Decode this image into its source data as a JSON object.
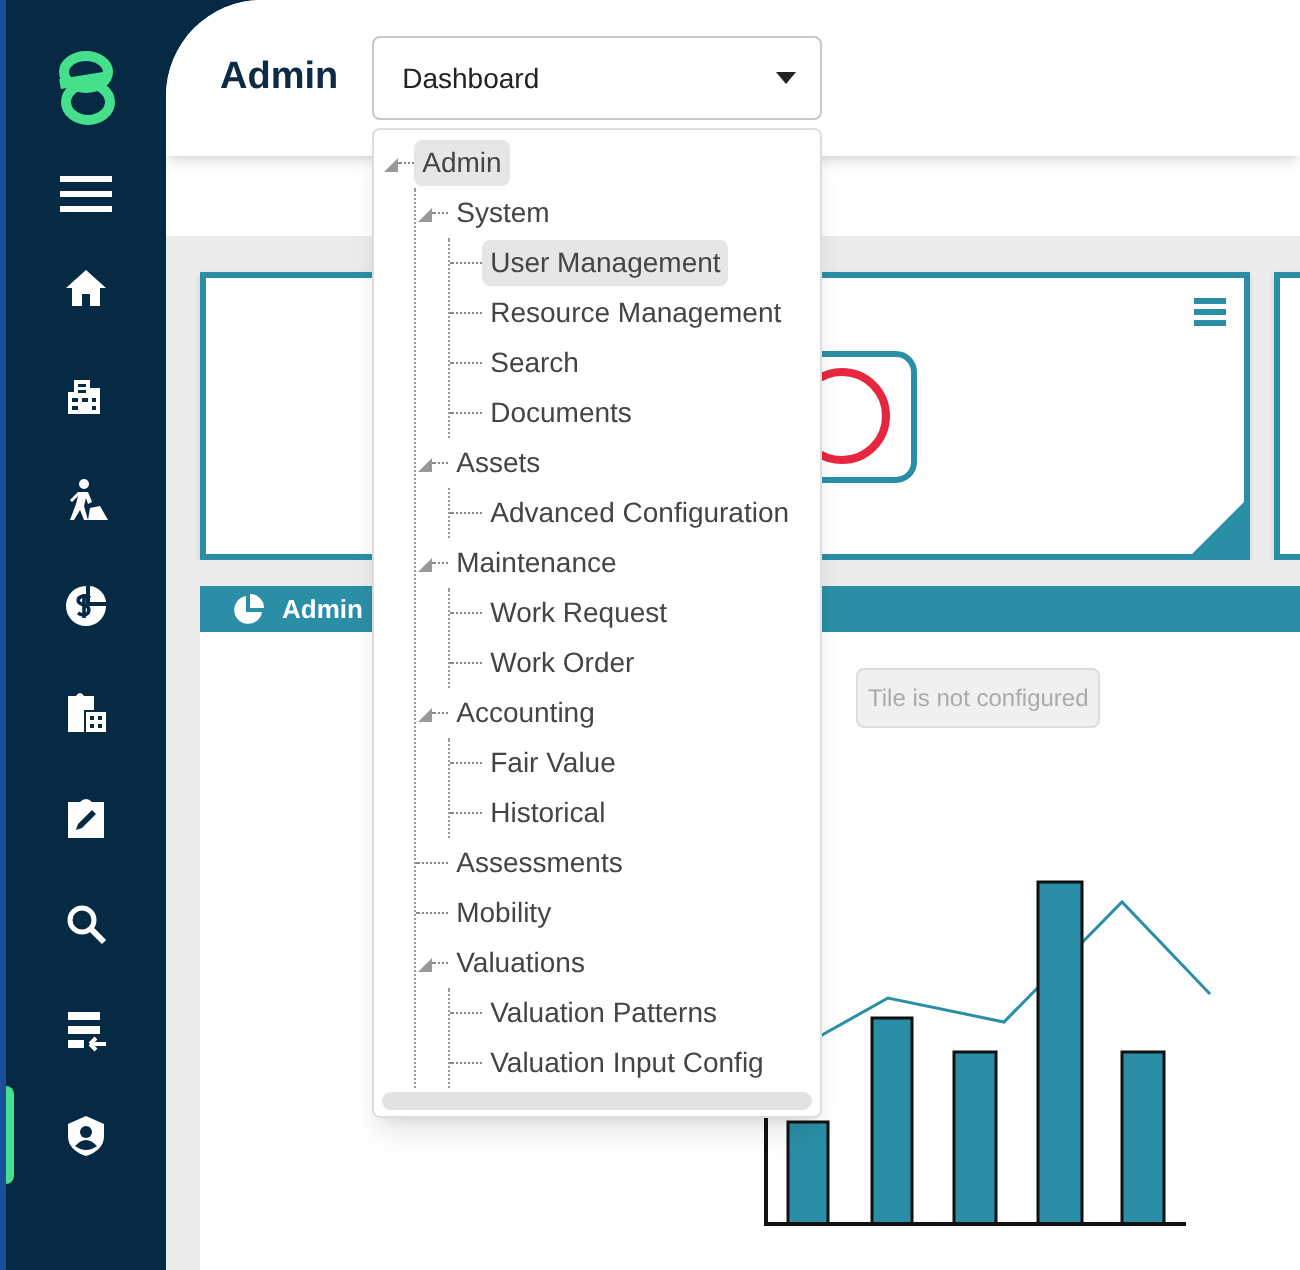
{
  "sidebar": {
    "items": [
      {
        "kind": "home",
        "selected": false
      },
      {
        "kind": "building",
        "selected": false
      },
      {
        "kind": "worker",
        "selected": false
      },
      {
        "kind": "dollar",
        "selected": false
      },
      {
        "kind": "calculator",
        "selected": false
      },
      {
        "kind": "edit",
        "selected": false
      },
      {
        "kind": "search",
        "selected": false
      },
      {
        "kind": "import",
        "selected": false
      },
      {
        "kind": "shield",
        "selected": true
      }
    ]
  },
  "header": {
    "title": "Admin",
    "dropdown": {
      "value": "Dashboard",
      "expanded": true
    }
  },
  "tree": [
    {
      "label": "Admin",
      "selected": true,
      "expanded": true,
      "children": [
        {
          "label": "System",
          "selected": false,
          "expanded": true,
          "children": [
            {
              "label": "User Management",
              "selected": true
            },
            {
              "label": "Resource Management",
              "selected": false
            },
            {
              "label": "Search",
              "selected": false
            },
            {
              "label": "Documents",
              "selected": false
            }
          ]
        },
        {
          "label": "Assets",
          "selected": false,
          "expanded": true,
          "children": [
            {
              "label": "Advanced Configuration",
              "selected": false
            }
          ]
        },
        {
          "label": "Maintenance",
          "selected": false,
          "expanded": true,
          "children": [
            {
              "label": "Work Request",
              "selected": false
            },
            {
              "label": "Work Order",
              "selected": false
            }
          ]
        },
        {
          "label": "Accounting",
          "selected": false,
          "expanded": true,
          "children": [
            {
              "label": "Fair Value",
              "selected": false
            },
            {
              "label": "Historical",
              "selected": false
            }
          ]
        },
        {
          "label": "Assessments",
          "selected": false
        },
        {
          "label": "Mobility",
          "selected": false
        },
        {
          "label": "Valuations",
          "selected": false,
          "expanded": true,
          "children": [
            {
              "label": "Valuation Patterns",
              "selected": false
            },
            {
              "label": "Valuation Input Config",
              "selected": false
            }
          ]
        }
      ]
    }
  ],
  "panel": {
    "title": "Admin",
    "message": "Tile is not configured"
  }
}
